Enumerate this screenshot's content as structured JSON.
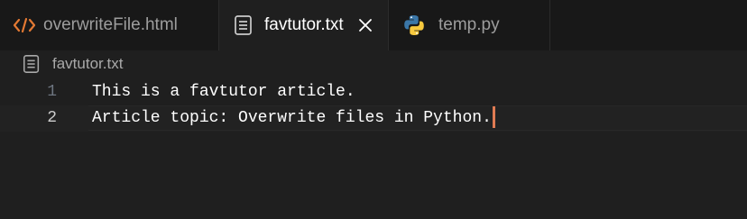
{
  "tabs": [
    {
      "label": "overwriteFile.html",
      "icon": "html-code-icon",
      "active": false
    },
    {
      "label": "favtutor.txt",
      "icon": "text-file-icon",
      "active": true
    },
    {
      "label": "temp.py",
      "icon": "python-icon",
      "active": false
    }
  ],
  "breadcrumb": {
    "file": "favtutor.txt",
    "icon": "text-file-icon"
  },
  "editor": {
    "lines": [
      {
        "number": "1",
        "text": "This is a favtutor article."
      },
      {
        "number": "2",
        "text": "Article topic: Overwrite files in Python."
      }
    ],
    "current_line": 2
  },
  "colors": {
    "editor_bg": "#1f1f1f",
    "tabbar_bg": "#181818",
    "html_icon": "#e37933",
    "cursor": "#e07b53",
    "python_blue": "#3b77a8",
    "python_yellow": "#f7c93e"
  }
}
